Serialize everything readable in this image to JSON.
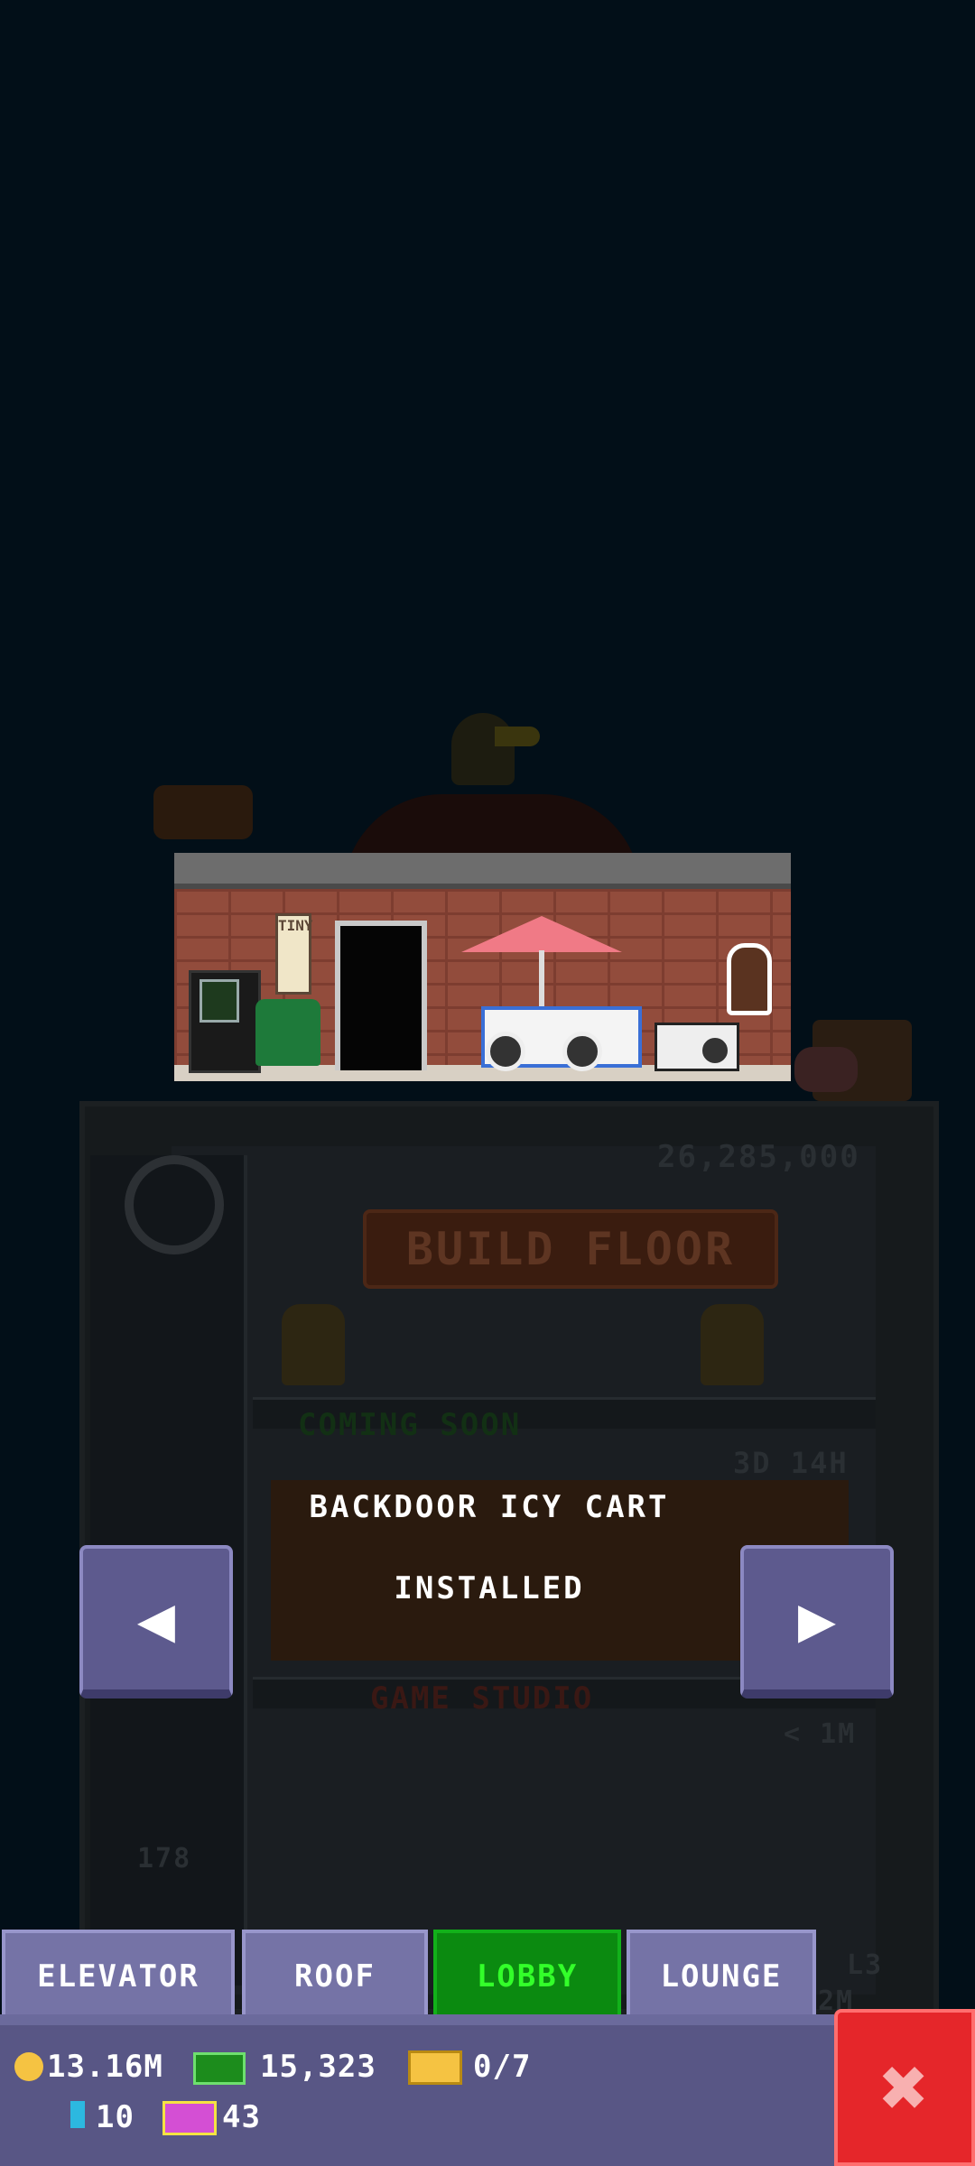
{
  "tower": {
    "price": "26,285,000",
    "build_label": "BUILD FLOOR",
    "coming_soon": "COMING SOON",
    "timer": "3D 14H",
    "floor_name": "GAME STUDIO",
    "floor_income": "< 1M",
    "floor_number": "178",
    "side_labels": [
      "L3",
      "2M"
    ]
  },
  "roof_preview": {
    "banner_text": "TINY"
  },
  "message": {
    "title": "BACKDOOR ICY CART",
    "status": "INSTALLED"
  },
  "nav": {
    "prev_icon": "left-arrow-icon",
    "next_icon": "right-arrow-icon"
  },
  "tabs": [
    {
      "label": "ELEVATOR",
      "active": false
    },
    {
      "label": "ROOF",
      "active": false
    },
    {
      "label": "LOBBY",
      "active": true
    },
    {
      "label": "LOUNGE",
      "active": false
    }
  ],
  "stats": {
    "coins": "13.16M",
    "bux": "15,323",
    "tickets": "0/7",
    "gems": "10",
    "vip": "43"
  },
  "colors": {
    "background": "#020f18",
    "tab": "#7573a6",
    "tab_active": "#0b8a10",
    "tab_active_text": "#33ff2a",
    "close": "#e5262a"
  }
}
